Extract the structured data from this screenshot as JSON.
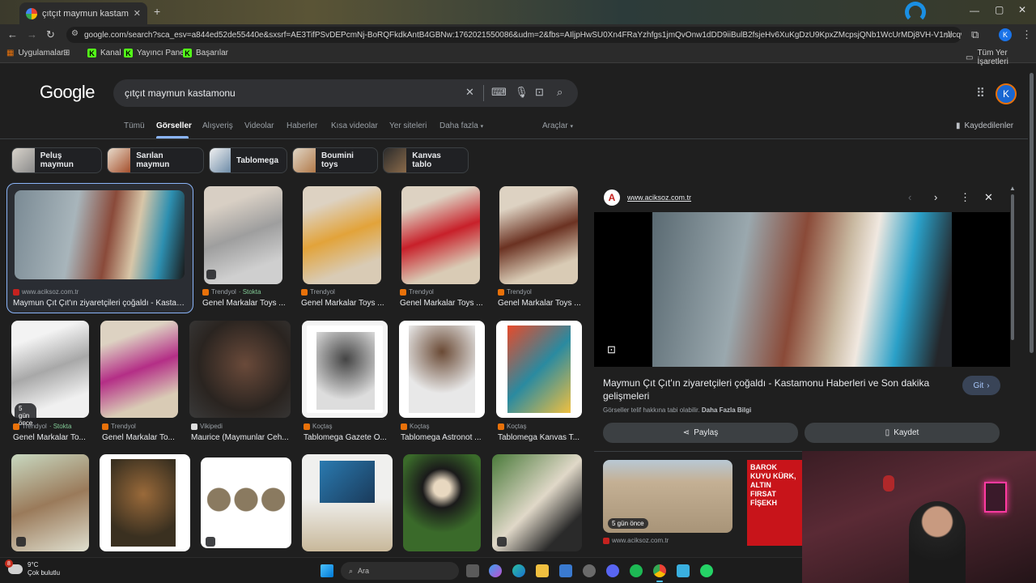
{
  "browser": {
    "tab_title": "çıtçıt maymun kastamonu - Go",
    "new_tab": "+",
    "url": "google.com/search?sca_esv=a844ed52de55440e&sxsrf=AE3TifPSvDEPcmNj-BoRQFkdkAntB4GBNw:1762021550086&udm=2&fbs=AIljpHwSU0Xn4FRaYzhfgs1jmQvOnw1dDD9iiBulB2fsjeHv6XuKgDzU9KpxZMcpsjQNb1WcUrMDj8VH-V1nIlcqw593jWT8Hr1...",
    "bookmarks": [
      {
        "label": "Uygulamalar"
      },
      {
        "label": "Kanal"
      },
      {
        "label": "Yayıncı Paneli"
      },
      {
        "label": "Başarılar"
      }
    ],
    "all_bookmarks": "Tüm Yer İşaretleri",
    "profile_letter": "K"
  },
  "google": {
    "logo": "Google",
    "query": "çıtçıt maymun kastamonu",
    "profile_letter": "K",
    "tabs": [
      "Tümü",
      "Görseller",
      "Alışveriş",
      "Videolar",
      "Haberler",
      "Kısa videolar",
      "Yer siteleri",
      "Daha fazla"
    ],
    "tools": "Araçlar",
    "saved": "Kaydedilenler",
    "chips": [
      "Peluş maymun",
      "Sarılan maymun",
      "Tablomega",
      "Boumini toys",
      "Kanvas tablo"
    ]
  },
  "results": {
    "row1": [
      {
        "source": "www.aciksoz.com.tr",
        "caption": "Maymun Çıt Çıt'ın ziyaretçileri çoğaldı - Kastam..."
      },
      {
        "source": "Trendyol",
        "stock": "· Stokta",
        "caption": "Genel Markalar Toys ..."
      },
      {
        "source": "Trendyol",
        "caption": "Genel Markalar Toys ..."
      },
      {
        "source": "Trendyol",
        "caption": "Genel Markalar Toys ..."
      },
      {
        "source": "Trendyol",
        "caption": "Genel Markalar Toys ..."
      }
    ],
    "row2": [
      {
        "source": "Trendyol",
        "stock": "· Stokta",
        "caption": "Genel Markalar To...",
        "badge": "5 gün önce"
      },
      {
        "source": "Trendyol",
        "caption": "Genel Markalar To..."
      },
      {
        "source": "Vikipedi",
        "caption": "Maurice (Maymunlar Ceh..."
      },
      {
        "source": "Koçtaş",
        "caption": "Tablomega Gazete O..."
      },
      {
        "source": "Koçtaş",
        "caption": "Tablomega Astronot ..."
      },
      {
        "source": "Koçtaş",
        "caption": "Tablomega Kanvas T..."
      }
    ]
  },
  "panel": {
    "source": "www.aciksoz.com.tr",
    "title": "Maymun Çıt Çıt'ın ziyaretçileri çoğaldı - Kastamonu Haberleri ve Son dakika gelişmeleri",
    "go": "Git",
    "note": "Görseller telif hakkına tabi olabilir.",
    "more_info": "Daha Fazla Bilgi",
    "share": "Paylaş",
    "save": "Kaydet",
    "related_badge": "5 gün önce",
    "related_source": "www.aciksoz.com.tr",
    "related2_text": "BAROK KUYU KÜRK, ALTIN FIRSAT FİŞEKH"
  },
  "taskbar": {
    "weather_temp": "9°C",
    "weather_desc": "Çok bulutlu",
    "weather_badge": "8",
    "search_placeholder": "Ara"
  },
  "colors": {
    "accent": "#8ab4f8",
    "stock": "#81c995",
    "background": "#1f1f1f"
  }
}
